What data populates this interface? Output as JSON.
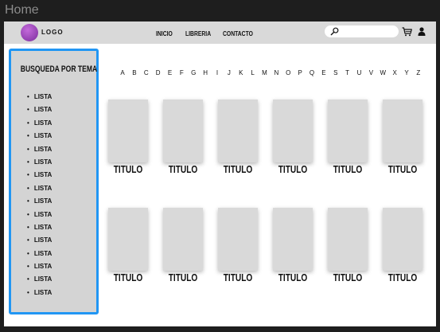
{
  "window": {
    "title": "Home"
  },
  "header": {
    "logo_text": "LOGO",
    "nav": [
      "INICIO",
      "LIBRERIA",
      "CONTACTO"
    ]
  },
  "sidebar": {
    "title": "BUSQUEDA POR TEMA",
    "items": [
      "LISTA",
      "LISTA",
      "LISTA",
      "LISTA",
      "LISTA",
      "LISTA",
      "LISTA",
      "LISTA",
      "LISTA",
      "LISTA",
      "LISTA",
      "LISTA",
      "LISTA",
      "LISTA",
      "LISTA",
      "LISTA"
    ]
  },
  "alphabet": [
    "A",
    "B",
    "C",
    "D",
    "E",
    "F",
    "G",
    "H",
    "I",
    "J",
    "K",
    "L",
    "M",
    "N",
    "O",
    "P",
    "Q",
    "E",
    "S",
    "T",
    "U",
    "V",
    "W",
    "X",
    "Y",
    "Z"
  ],
  "books": {
    "row1": [
      "TITULO",
      "TITULO",
      "TITULO",
      "TITULO",
      "TITULO",
      "TITULO"
    ],
    "row2": [
      "TITULO",
      "TITULO",
      "TITULO",
      "TITULO",
      "TITULO",
      "TITULO"
    ]
  },
  "icons": [
    "search-icon",
    "cart-icon",
    "user-icon"
  ],
  "colors": {
    "accent": "#2196f3",
    "logo": "#9b46c2",
    "placeholder": "#d9d9d9",
    "header": "#d9d9d9"
  }
}
